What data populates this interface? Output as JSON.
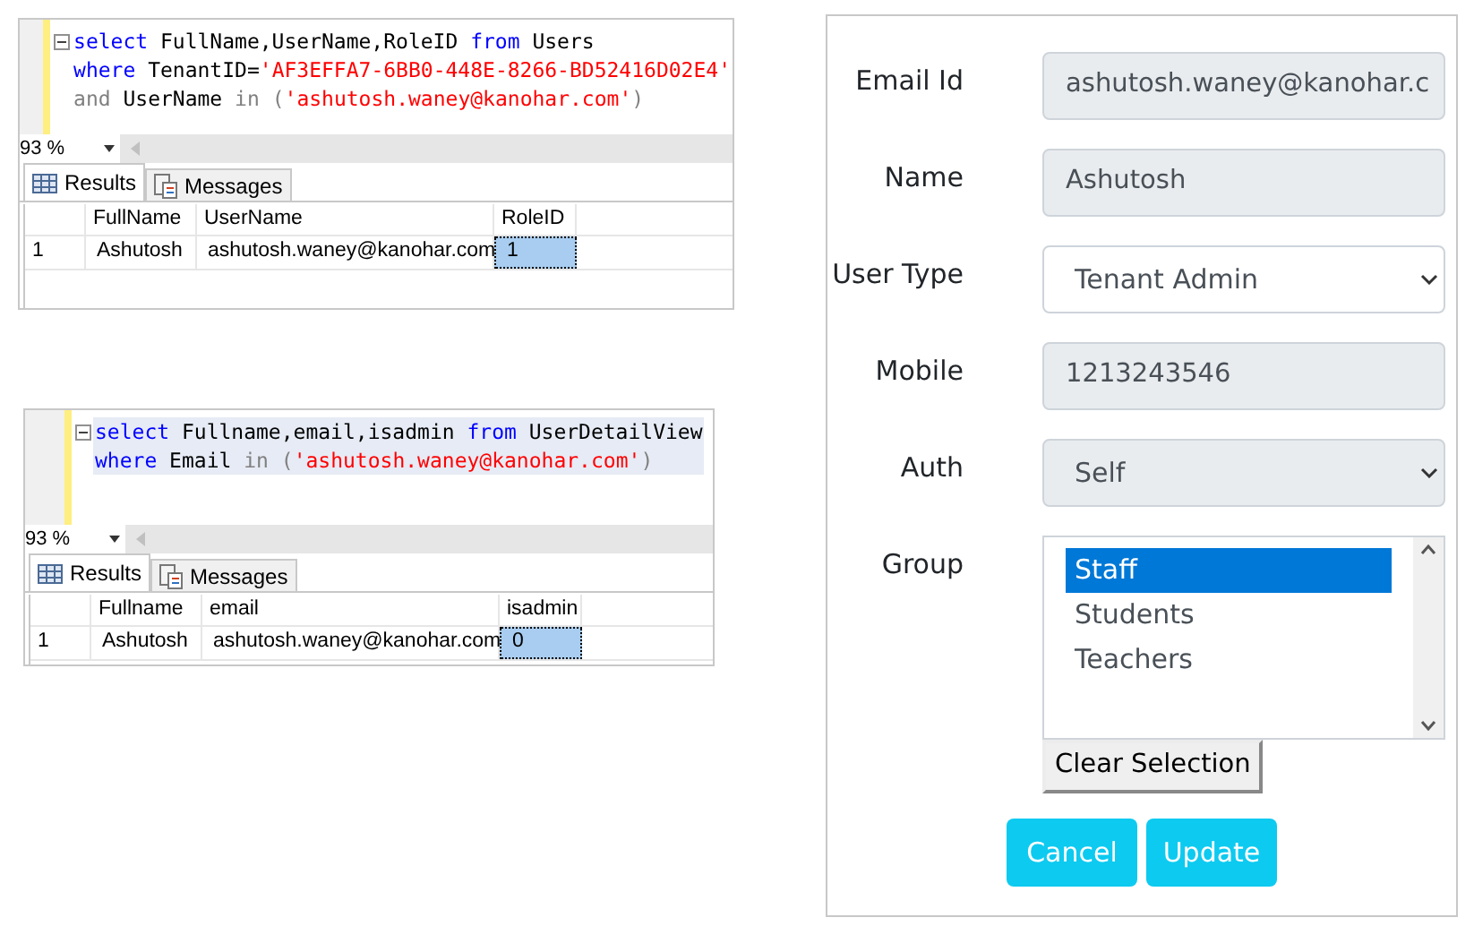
{
  "queries": [
    {
      "lines": [
        [
          {
            "kind": "keyword",
            "text": "select"
          },
          {
            "kind": "plain",
            "text": " FullName,UserName,RoleID "
          },
          {
            "kind": "keyword",
            "text": "from"
          },
          {
            "kind": "plain",
            "text": " Users"
          }
        ],
        [
          {
            "kind": "keyword",
            "text": "where"
          },
          {
            "kind": "plain",
            "text": " TenantID="
          },
          {
            "kind": "string",
            "text": "'AF3EFFA7-6BB0-448E-8266-BD52416D02E4'"
          }
        ],
        [
          {
            "kind": "operator",
            "text": "and"
          },
          {
            "kind": "plain",
            "text": " UserName "
          },
          {
            "kind": "operator",
            "text": "in"
          },
          {
            "kind": "operator",
            "text": " ("
          },
          {
            "kind": "string",
            "text": "'ashutosh.waney@kanohar.com'"
          },
          {
            "kind": "operator",
            "text": ")"
          }
        ]
      ],
      "zoom": "93 %",
      "tabs": [
        {
          "label": "Results",
          "selected": true
        },
        {
          "label": "Messages",
          "selected": false
        }
      ],
      "columns": [
        "FullName",
        "UserName",
        "RoleID"
      ],
      "rows": [
        {
          "number": "1",
          "cells": [
            {
              "text": "Ashutosh",
              "selected": false
            },
            {
              "text": "ashutosh.waney@kanohar.com",
              "selected": false
            },
            {
              "text": "1",
              "selected": true
            }
          ]
        }
      ]
    },
    {
      "lines": [
        [
          {
            "kind": "keyword",
            "text": "select"
          },
          {
            "kind": "plain",
            "text": " Fullname,email,isadmin "
          },
          {
            "kind": "keyword",
            "text": "from"
          },
          {
            "kind": "plain",
            "text": " UserDetailView"
          }
        ],
        [
          {
            "kind": "keyword",
            "text": "where"
          },
          {
            "kind": "plain",
            "text": " Email "
          },
          {
            "kind": "operator",
            "text": "in"
          },
          {
            "kind": "operator",
            "text": " ("
          },
          {
            "kind": "string",
            "text": "'ashutosh.waney@kanohar.com'"
          },
          {
            "kind": "operator",
            "text": ")"
          }
        ]
      ],
      "zoom": "93 %",
      "tabs": [
        {
          "label": "Results",
          "selected": true
        },
        {
          "label": "Messages",
          "selected": false
        }
      ],
      "columns": [
        "Fullname",
        "email",
        "isadmin"
      ],
      "rows": [
        {
          "number": "1",
          "cells": [
            {
              "text": "Ashutosh",
              "selected": false
            },
            {
              "text": "ashutosh.waney@kanohar.com",
              "selected": false
            },
            {
              "text": "0",
              "selected": true
            }
          ]
        }
      ]
    }
  ],
  "form": {
    "fields": [
      {
        "kind": "text",
        "label": "Email Id",
        "value": "ashutosh.waney@kanohar.c",
        "disabled": true
      },
      {
        "kind": "text",
        "label": "Name",
        "value": "Ashutosh",
        "disabled": true
      },
      {
        "kind": "select",
        "label": "User Type",
        "value": "Tenant Admin",
        "disabled": false
      },
      {
        "kind": "text",
        "label": "Mobile",
        "value": "1213243546",
        "disabled": true
      },
      {
        "kind": "select",
        "label": "Auth",
        "value": "Self",
        "disabled": true
      },
      {
        "kind": "listbox",
        "label": "Group",
        "options": [
          {
            "label": "Staff",
            "selected": true
          },
          {
            "label": "Students",
            "selected": false
          },
          {
            "label": "Teachers",
            "selected": false
          }
        ],
        "clear_button": "Clear Selection"
      }
    ],
    "buttons": [
      "Cancel",
      "Update"
    ]
  }
}
